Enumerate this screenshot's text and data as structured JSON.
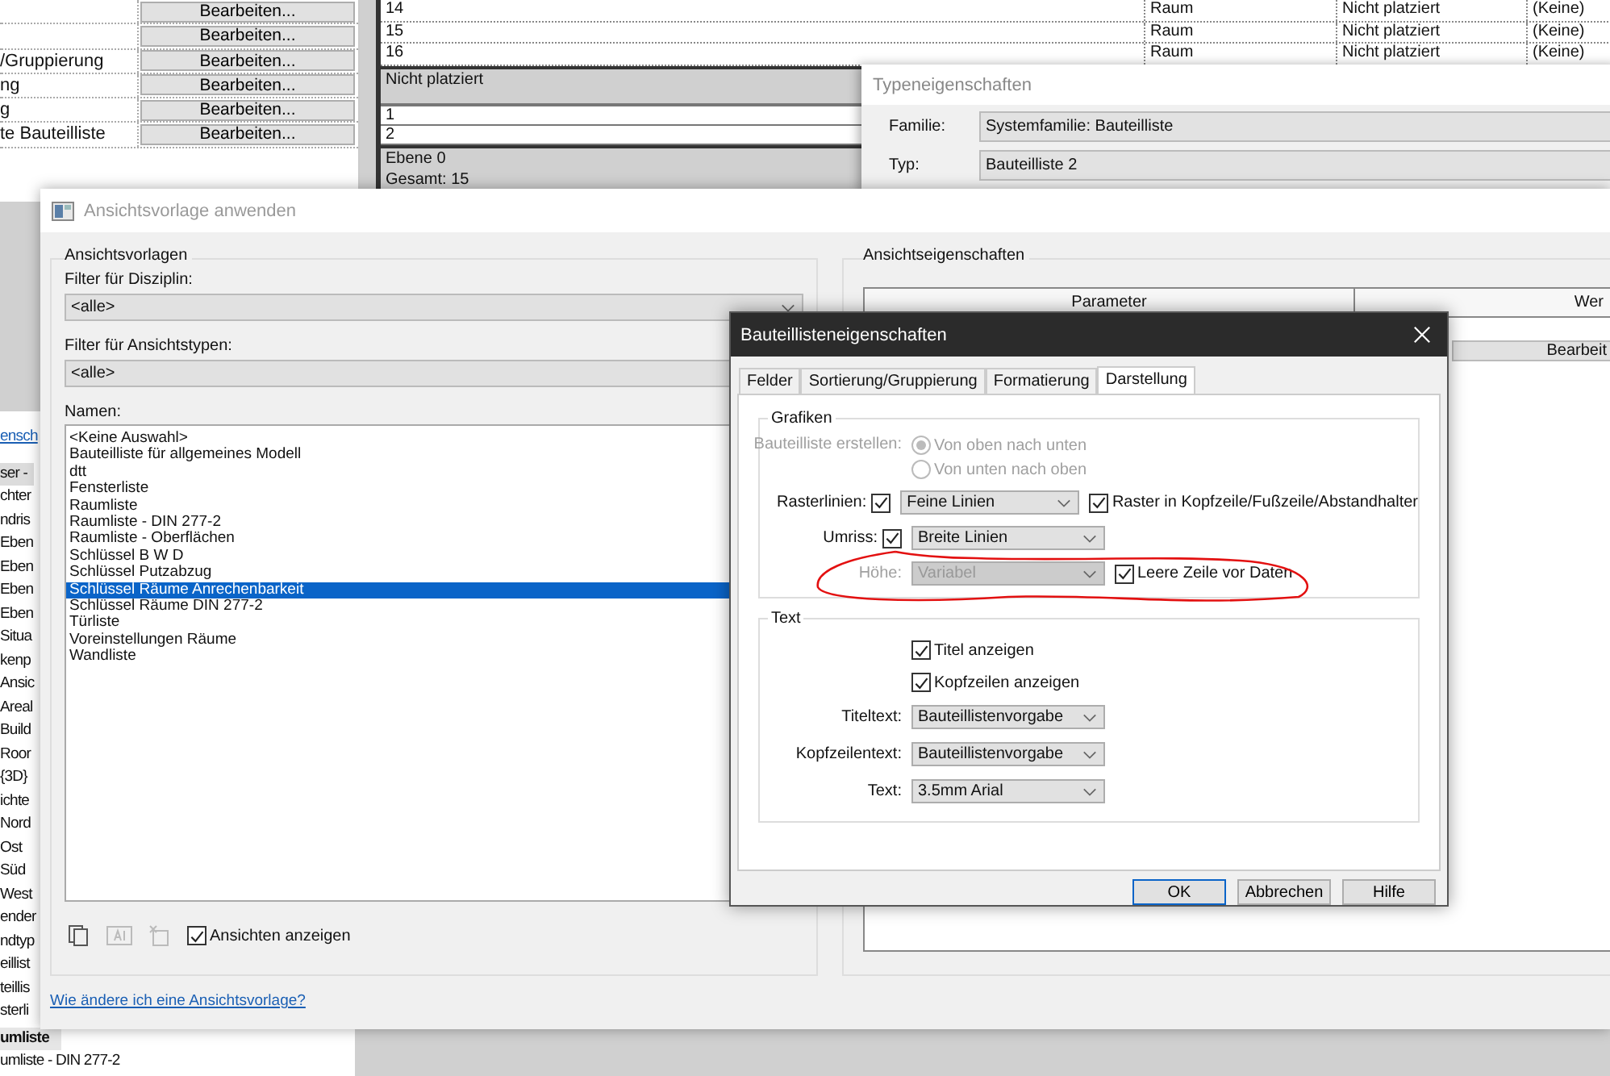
{
  "properties_panel": {
    "rows": [
      {
        "button": "Bearbeiten..."
      },
      {
        "button": "Bearbeiten..."
      },
      {
        "label": "/Gruppierung",
        "button": "Bearbeiten..."
      },
      {
        "label": "ng",
        "button": "Bearbeiten..."
      },
      {
        "label": "g",
        "button": "Bearbeiten..."
      },
      {
        "label": "te Bauteilliste",
        "button": "Bearbeiten..."
      }
    ]
  },
  "schedule": {
    "rows": [
      {
        "column_1": "14",
        "column_2": "Raum",
        "column_3": "Nicht platziert",
        "column_4": "(Keine)"
      },
      {
        "column_1": "15",
        "column_2": "Raum",
        "column_3": "Nicht platziert",
        "column_4": "(Keine)"
      },
      {
        "column_1": "16",
        "column_2": "Raum",
        "column_3": "Nicht platziert",
        "column_4": "(Keine)"
      }
    ],
    "group_header": "Nicht platziert",
    "group_rows": [
      "1",
      "2"
    ],
    "footer": [
      "Ebene 0",
      "Gesamt: 15"
    ]
  },
  "type_properties": {
    "title": "Typeneigenschaften",
    "family_label": "Familie:",
    "family": "Systemfamilie: Bauteilliste",
    "type_label": "Typ:",
    "type": "Bauteilliste 2"
  },
  "browser": {
    "items": [
      {
        "text": "ensch",
        "kind": "link"
      },
      {
        "text": "ser - ",
        "kind": "header"
      },
      {
        "text": "chter",
        "kind": "item"
      },
      {
        "text": "ndris",
        "kind": "item"
      },
      {
        "text": "Eben",
        "kind": "item"
      },
      {
        "text": "Eben",
        "kind": "item"
      },
      {
        "text": "Eben",
        "kind": "item"
      },
      {
        "text": "Eben",
        "kind": "item"
      },
      {
        "text": "Situa",
        "kind": "item"
      },
      {
        "text": "kenp",
        "kind": "item"
      },
      {
        "text": "Ansic",
        "kind": "item"
      },
      {
        "text": "Areal",
        "kind": "item"
      },
      {
        "text": "Build",
        "kind": "item"
      },
      {
        "text": "Roor",
        "kind": "item"
      },
      {
        "text": "{3D}",
        "kind": "item"
      },
      {
        "text": "ichte",
        "kind": "item"
      },
      {
        "text": "Nord",
        "kind": "item"
      },
      {
        "text": "Ost",
        "kind": "item"
      },
      {
        "text": "Süd",
        "kind": "item"
      },
      {
        "text": "West",
        "kind": "item"
      },
      {
        "text": "ender",
        "kind": "item"
      },
      {
        "text": "ndtyp",
        "kind": "item"
      },
      {
        "text": "eillist",
        "kind": "item"
      },
      {
        "text": "teillis",
        "kind": "item"
      },
      {
        "text": "sterli",
        "kind": "item"
      },
      {
        "text": "umliste",
        "kind": "bold"
      },
      {
        "text": "umliste - DIN 277-2",
        "kind": "item"
      }
    ]
  },
  "apply_dialog": {
    "title": "Ansichtsvorlage anwenden",
    "group": "Ansichtsvorlagen",
    "discipline_label": "Filter für Disziplin:",
    "discipline_value": "<alle>",
    "viewtype_label": "Filter für Ansichtstypen:",
    "viewtype_value": "<alle>",
    "names_label": "Namen:",
    "names": [
      {
        "text": "<Keine Auswahl>",
        "selected": false
      },
      {
        "text": "Bauteilliste für allgemeines Modell",
        "selected": false
      },
      {
        "text": "dtt",
        "selected": false
      },
      {
        "text": "Fensterliste",
        "selected": false
      },
      {
        "text": "Raumliste",
        "selected": false
      },
      {
        "text": "Raumliste - DIN 277-2",
        "selected": false
      },
      {
        "text": "Raumliste - Oberflächen",
        "selected": false
      },
      {
        "text": "Schlüssel B W D",
        "selected": false
      },
      {
        "text": "Schlüssel Putzabzug",
        "selected": false
      },
      {
        "text": "Schlüssel Räume Anrechenbarkeit",
        "selected": true
      },
      {
        "text": "Schlüssel Räume DIN 277-2",
        "selected": false
      },
      {
        "text": "Türliste",
        "selected": false
      },
      {
        "text": "Voreinstellungen Räume",
        "selected": false
      },
      {
        "text": "Wandliste",
        "selected": false
      }
    ],
    "show_views": {
      "label": "Ansichten anzeigen",
      "checked": true
    },
    "help_link": "Wie ändere ich eine Ansichtsvorlage?",
    "properties_group": "Ansichtseigenschaften",
    "table_columns": [
      "Parameter",
      "Wer"
    ],
    "edit_cell": "Bearbeit"
  },
  "schedule_dialog": {
    "title": "Bauteillisteneigenschaften",
    "tabs": [
      {
        "label": "Felder",
        "selected": false
      },
      {
        "label": "Sortierung/Gruppierung",
        "selected": false
      },
      {
        "label": "Formatierung",
        "selected": false
      },
      {
        "label": "Darstellung",
        "selected": true
      }
    ],
    "graphics_group": "Grafiken",
    "create_label": "Bauteilliste erstellen:",
    "create_options": [
      {
        "label": "Von oben nach unten",
        "selected": true
      },
      {
        "label": "Von unten nach oben",
        "selected": false
      }
    ],
    "grid_label": "Rasterlinien:",
    "grid_checked": true,
    "grid_value": "Feine Linien",
    "grid_header": {
      "label": "Raster in Kopfzeile/Fußzeile/Abstandhalter",
      "checked": true
    },
    "outline_label": "Umriss:",
    "outline_checked": true,
    "outline_value": "Breite Linien",
    "height_label": "Höhe:",
    "height_value": "Variabel",
    "height_disabled": true,
    "blank_row": {
      "label": "Leere Zeile vor Daten",
      "checked": true
    },
    "text_group": "Text",
    "show_title": {
      "label": "Titel anzeigen",
      "checked": true
    },
    "show_headers": {
      "label": "Kopfzeilen anzeigen",
      "checked": true
    },
    "text_dropdowns": [
      {
        "label": "Titeltext:",
        "value": "Bauteillistenvorgabe"
      },
      {
        "label": "Kopfzeilentext:",
        "value": "Bauteillistenvorgabe"
      },
      {
        "label": "Text:",
        "value": "3.5mm Arial"
      }
    ],
    "buttons": [
      {
        "label": "OK",
        "default": true
      },
      {
        "label": "Abbrechen",
        "default": false
      },
      {
        "label": "Hilfe",
        "default": false
      }
    ]
  }
}
